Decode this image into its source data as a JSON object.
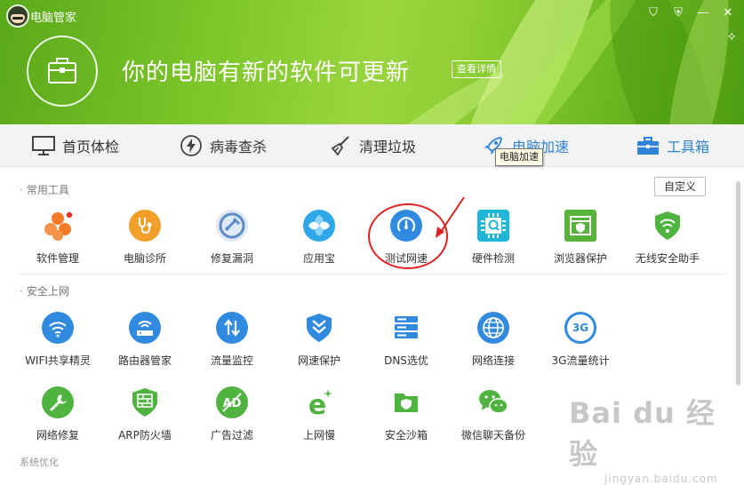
{
  "app": {
    "title": "电脑管家"
  },
  "window_controls": [
    {
      "name": "shield-icon",
      "glyph": "⛉"
    },
    {
      "name": "skin-icon",
      "glyph": "⛨"
    },
    {
      "name": "minimize-icon",
      "glyph": "—"
    },
    {
      "name": "close-icon",
      "glyph": "✕"
    }
  ],
  "hero": {
    "message": "你的电脑有新的软件可更新",
    "details_button": "查看详情"
  },
  "nav": {
    "items": [
      {
        "label": "首页体检",
        "icon": "monitor-icon"
      },
      {
        "label": "病毒查杀",
        "icon": "lightning-icon"
      },
      {
        "label": "清理垃圾",
        "icon": "broom-icon"
      },
      {
        "label": "电脑加速",
        "icon": "rocket-icon"
      },
      {
        "label": "工具箱",
        "icon": "toolbox-icon"
      }
    ],
    "tooltip": "电脑加速"
  },
  "sections": {
    "common": {
      "title": "常用工具",
      "customize_button": "自定义",
      "tools": [
        {
          "label": "软件管理",
          "icon": "software-management-icon",
          "color": "#f47a2a"
        },
        {
          "label": "电脑诊所",
          "icon": "stethoscope-icon",
          "color": "#f3a02b"
        },
        {
          "label": "修复漏洞",
          "icon": "repair-icon",
          "color": "#5b8cc4"
        },
        {
          "label": "应用宝",
          "icon": "app-store-icon",
          "color": "#2ea7e8"
        },
        {
          "label": "测试网速",
          "icon": "speedometer-icon",
          "color": "#2f8ae0"
        },
        {
          "label": "硬件检测",
          "icon": "chip-icon",
          "color": "#1fb6d8"
        },
        {
          "label": "浏览器保护",
          "icon": "browser-shield-icon",
          "color": "#57b33a"
        },
        {
          "label": "无线安全助手",
          "icon": "wifi-shield-icon",
          "color": "#4fb33f"
        }
      ]
    },
    "security": {
      "title": "安全上网",
      "tools": [
        {
          "label": "WIFI共享精灵",
          "icon": "wifi-icon",
          "color": "#2f8ae0"
        },
        {
          "label": "路由器管家",
          "icon": "router-icon",
          "color": "#2f8ae0"
        },
        {
          "label": "流量监控",
          "icon": "traffic-icon",
          "color": "#2f8ae0"
        },
        {
          "label": "网速保护",
          "icon": "speed-protect-icon",
          "color": "#2f8ae0"
        },
        {
          "label": "DNS选优",
          "icon": "dns-icon",
          "color": "#2f8ae0"
        },
        {
          "label": "网络连接",
          "icon": "globe-icon",
          "color": "#2f8ae0"
        },
        {
          "label": "3G流量统计",
          "icon": "3g-icon",
          "color": "#2f8ae0"
        },
        {
          "label": "网络修复",
          "icon": "wrench-icon",
          "color": "#4fb33f"
        },
        {
          "label": "ARP防火墙",
          "icon": "firewall-icon",
          "color": "#4fb33f"
        },
        {
          "label": "广告过滤",
          "icon": "ad-block-icon",
          "color": "#4fb33f"
        },
        {
          "label": "上网慢",
          "icon": "slow-net-icon",
          "color": "#4fb33f"
        },
        {
          "label": "安全沙箱",
          "icon": "sandbox-icon",
          "color": "#4fb33f"
        },
        {
          "label": "微信聊天备份",
          "icon": "wechat-icon",
          "color": "#4fb33f"
        }
      ]
    },
    "optimize": {
      "title": "系统优化"
    }
  },
  "watermark": {
    "main": "Bai du 经验",
    "sub": "jingyan.baidu.com"
  }
}
